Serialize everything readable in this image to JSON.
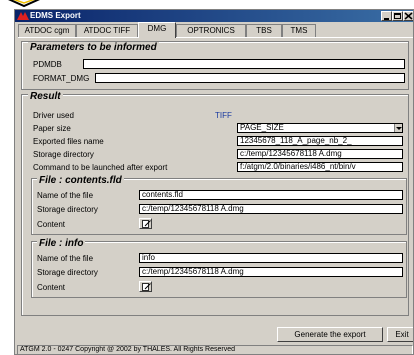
{
  "window": {
    "title": "EDMS Export",
    "tabs": [
      {
        "label": "ATDOC cgm",
        "active": false
      },
      {
        "label": "ATDOC TIFF",
        "active": false
      },
      {
        "label": "DMG",
        "active": true
      },
      {
        "label": "OPTRONICS",
        "active": false
      },
      {
        "label": "TBS",
        "active": false
      },
      {
        "label": "TMS",
        "active": false
      }
    ]
  },
  "parameters": {
    "title": "Parameters to be informed",
    "pdmdb_label": "PDMDB",
    "pdmdb_value": "",
    "format_label": "FORMAT_DMG",
    "format_value": ""
  },
  "result": {
    "title": "Result",
    "driver_label": "Driver used",
    "driver_value": "TIFF",
    "paper_label": "Paper size",
    "paper_value": "PAGE_SIZE",
    "exported_label": "Exported files name",
    "exported_value": "12345678_118_A_page_nb_2_",
    "storage_label": "Storage directory",
    "storage_value": "c:/temp/12345678118 A.dmg",
    "command_label": "Command to be launched after export",
    "command_value": "f:/atgm/2.0/binaries/i486_nt/bin/v"
  },
  "file_contents": {
    "title": "File : contents.fld",
    "name_label": "Name of the file",
    "name_value": "contents.fld",
    "storage_label": "Storage directory",
    "storage_value": "c:/temp/12345678118 A.dmg",
    "content_label": "Content"
  },
  "file_info": {
    "title": "File : info",
    "name_label": "Name of the file",
    "name_value": "info",
    "storage_label": "Storage directory",
    "storage_value": "c:/temp/12345678118 A.dmg",
    "content_label": "Content"
  },
  "buttons": {
    "generate": "Generate the export",
    "exit": "Exit"
  },
  "status": {
    "text": "ATGM 2.0 - 0247 Copyright @ 2002 by THALES. All Rights Reserved"
  },
  "colors": {
    "title_bar": "#0a246a",
    "window_bg": "#d4d0c8",
    "driver_text": "#1a3aa0"
  },
  "icons": {
    "app": "app-logo-icon",
    "minimize": "minimize-icon",
    "maximize": "maximize-icon",
    "close": "close-icon",
    "content_edit": "document-edit-icon"
  }
}
